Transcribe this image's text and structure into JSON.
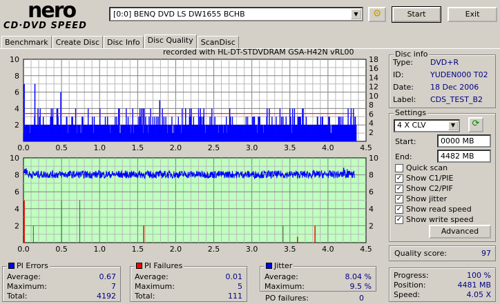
{
  "app": {
    "logo_top": "nero",
    "logo_bottom": "CD·DVD SPEED"
  },
  "toolbar": {
    "drive": "[0:0]  BENQ DVD LS DW1655 BCHB",
    "start": "Start",
    "exit": "Exit"
  },
  "tabs": [
    "Benchmark",
    "Create Disc",
    "Disc Info",
    "Disc Quality",
    "ScanDisc"
  ],
  "active_tab": "Disc Quality",
  "disc_info": {
    "title": "Disc info",
    "type_label": "Type:",
    "type": "DVD+R",
    "id_label": "ID:",
    "id": "YUDEN000 T02",
    "date_label": "Date:",
    "date": "18 Dec 2006",
    "label_label": "Label:",
    "label": "CDS_TEST_B2"
  },
  "settings": {
    "title": "Settings",
    "speed": "4 X CLV",
    "start_label": "Start:",
    "start": "0000 MB",
    "end_label": "End:",
    "end": "4482 MB",
    "checks": [
      {
        "label": "Quick scan",
        "checked": false
      },
      {
        "label": "Show C1/PIE",
        "checked": true
      },
      {
        "label": "Show C2/PIF",
        "checked": true
      },
      {
        "label": "Show jitter",
        "checked": true
      },
      {
        "label": "Show read speed",
        "checked": true
      },
      {
        "label": "Show write speed",
        "checked": true
      }
    ],
    "advanced": "Advanced"
  },
  "quality": {
    "label": "Quality score:",
    "value": "97"
  },
  "progress": {
    "progress_label": "Progress:",
    "progress": "100 %",
    "position_label": "Position:",
    "position": "4481 MB",
    "speed_label": "Speed:",
    "speed": "4.05 X"
  },
  "pi_errors": {
    "title": "PI Errors",
    "color": "#0000ff",
    "average_label": "Average:",
    "average": "0.67",
    "maximum_label": "Maximum:",
    "maximum": "7",
    "total_label": "Total:",
    "total": "4192"
  },
  "pi_failures": {
    "title": "PI Failures",
    "color": "#ff0000",
    "average_label": "Average:",
    "average": "0.01",
    "maximum_label": "Maximum:",
    "maximum": "5",
    "total_label": "Total:",
    "total": "111"
  },
  "jitter": {
    "title": "Jitter",
    "color": "#0000ff",
    "average_label": "Average:",
    "average": "8.04 %",
    "maximum_label": "Maximum:",
    "maximum": "9.5 %",
    "po_label": "PO failures:",
    "po": "0"
  },
  "chart_data": [
    {
      "type": "bar",
      "subtitle": "recorded with HL-DT-STDVDRAM GSA-H42N  vRL00",
      "xlim": [
        0,
        4.5
      ],
      "ylim": [
        0,
        10
      ],
      "y2lim": [
        0,
        18
      ],
      "xticks": [
        "0.0",
        "0.5",
        "1.0",
        "1.5",
        "2.0",
        "2.5",
        "3.0",
        "3.5",
        "4.0",
        "4.5"
      ],
      "yticks": [
        "2",
        "4",
        "6",
        "8",
        "10"
      ],
      "y2ticks": [
        "2",
        "4",
        "6",
        "8",
        "10",
        "12",
        "14",
        "16",
        "18"
      ],
      "grid": true,
      "series": [
        {
          "color": "#0000ff",
          "peaks": [
            [
              0.01,
              7
            ],
            [
              0.15,
              7
            ],
            [
              0.49,
              6
            ],
            [
              1.79,
              5
            ],
            [
              0.44,
              4
            ],
            [
              1.25,
              4
            ],
            [
              2.13,
              4
            ],
            [
              3.2,
              4
            ],
            [
              3.5,
              4
            ]
          ],
          "baseline": 2,
          "x_end": 4.37
        },
        {
          "color": "#ff0000",
          "type": "line",
          "axis": "right",
          "y": 6.1,
          "x_range": [
            0,
            4.35
          ]
        }
      ]
    },
    {
      "type": "line",
      "xlim": [
        0,
        4.5
      ],
      "ylim": [
        0,
        10
      ],
      "y2lim": [
        0,
        10
      ],
      "xticks": [
        "0.0",
        "0.5",
        "1.0",
        "1.5",
        "2.0",
        "2.5",
        "3.0",
        "3.5",
        "4.0",
        "4.5"
      ],
      "yticks": [
        "2",
        "4",
        "6",
        "8",
        "10"
      ],
      "y2ticks": [
        "2",
        "4",
        "6",
        "8",
        "10"
      ],
      "grid": true,
      "background": "#c0ffc0",
      "jitter": {
        "color": "#0000ff",
        "mean": 8.04,
        "max": 9.5,
        "x_end": 4.35
      },
      "pi_failures": {
        "color": "#ff0000",
        "spikes": [
          [
            0.01,
            5
          ],
          [
            1.58,
            2
          ],
          [
            3.83,
            2
          ],
          [
            3.6,
            0.7
          ]
        ]
      },
      "gray_spikes": [
        [
          0.13,
          2
        ],
        [
          0.5,
          5
        ],
        [
          0.74,
          5
        ],
        [
          3.41,
          2
        ]
      ]
    }
  ]
}
